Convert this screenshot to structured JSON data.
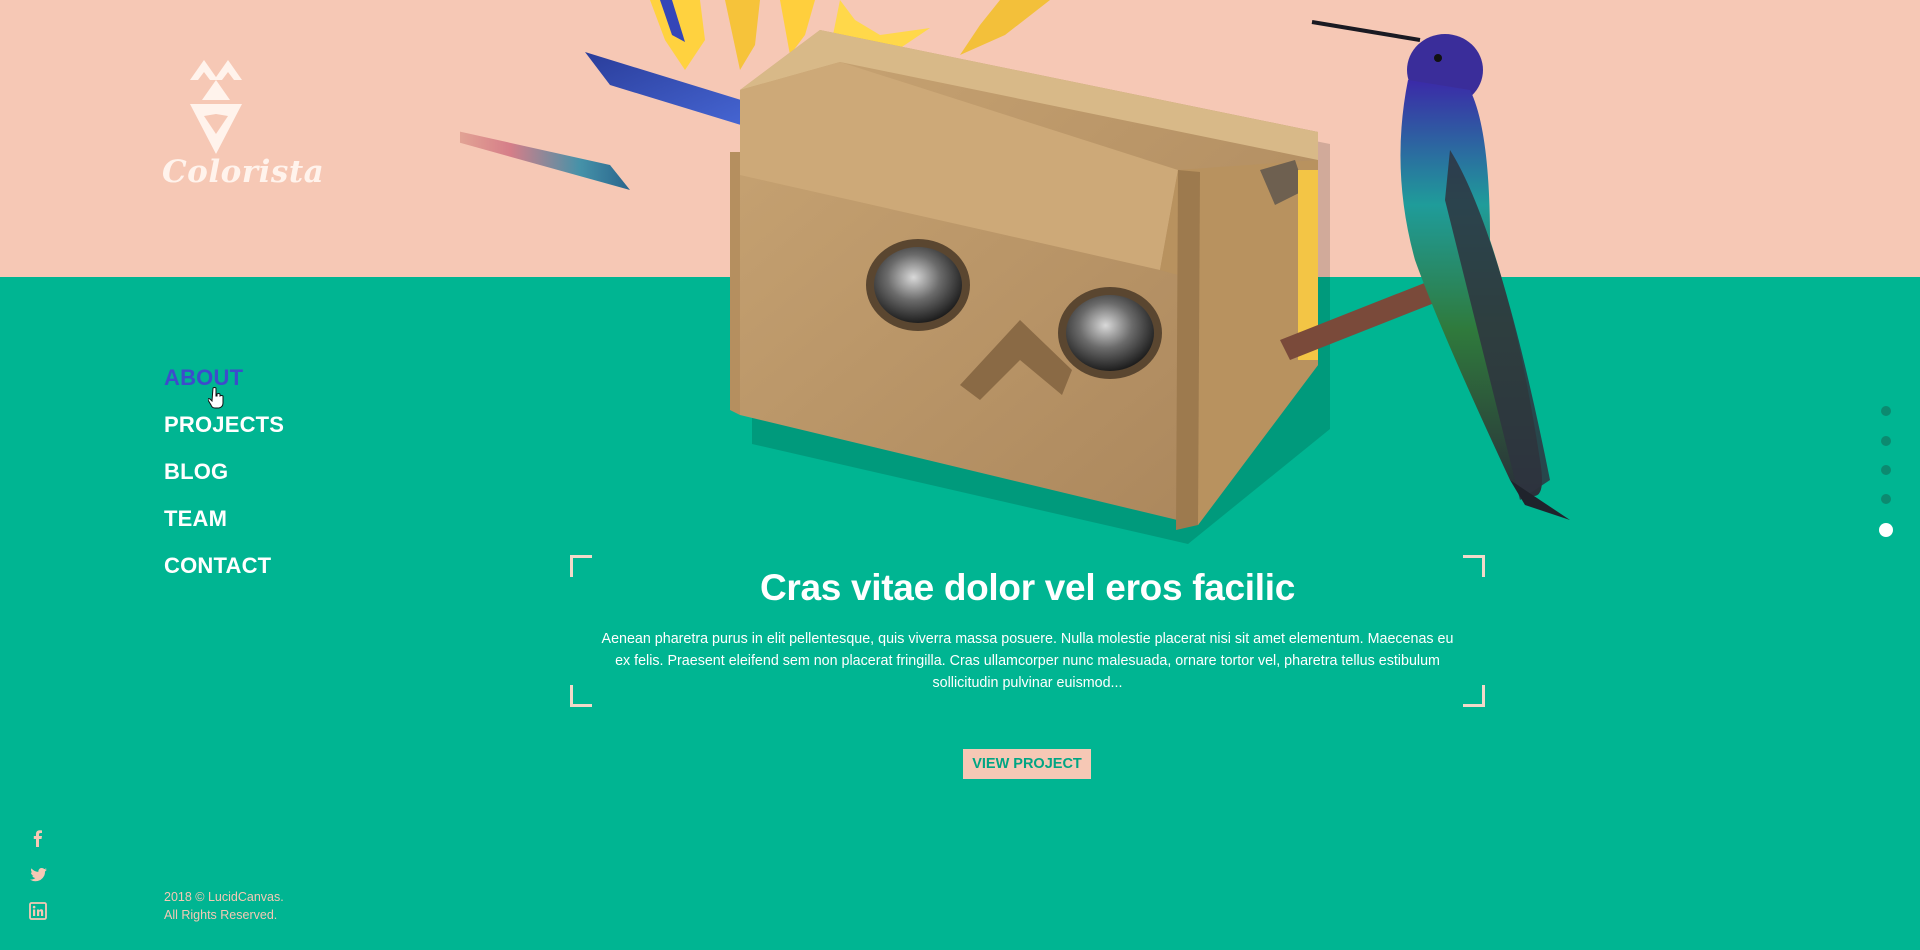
{
  "brand": {
    "name": "Colorista",
    "accent_peach": "#f6c8b5",
    "accent_green": "#00b592",
    "active_nav_color": "#3d4ccb"
  },
  "nav": {
    "items": [
      {
        "label": "ABOUT",
        "active": true
      },
      {
        "label": "PROJECTS",
        "active": false
      },
      {
        "label": "BLOG",
        "active": false
      },
      {
        "label": "TEAM",
        "active": false
      },
      {
        "label": "CONTACT",
        "active": false
      }
    ]
  },
  "hero": {
    "artwork_icons": [
      "cardboard-vr-headset",
      "bird-of-paradise-flower",
      "hummingbird"
    ]
  },
  "slide": {
    "title": "Cras vitae dolor vel eros facilic",
    "body": "Aenean pharetra purus in elit pellentesque, quis viverra massa posuere. Nulla molestie placerat nisi sit amet elementum. Maecenas eu ex felis. Praesent eleifend sem non placerat fringilla. Cras ullamcorper nunc malesuada, ornare tortor vel, pharetra tellus estibulum sollicitudin pulvinar euismod...",
    "cta_label": "VIEW PROJECT"
  },
  "pager": {
    "count": 5,
    "active_index": 4
  },
  "social": {
    "icons": [
      "facebook-icon",
      "twitter-icon",
      "linkedin-icon"
    ]
  },
  "footer": {
    "copyright_line1": "2018 © LucidCanvas.",
    "copyright_line2": "All Rights Reserved."
  }
}
